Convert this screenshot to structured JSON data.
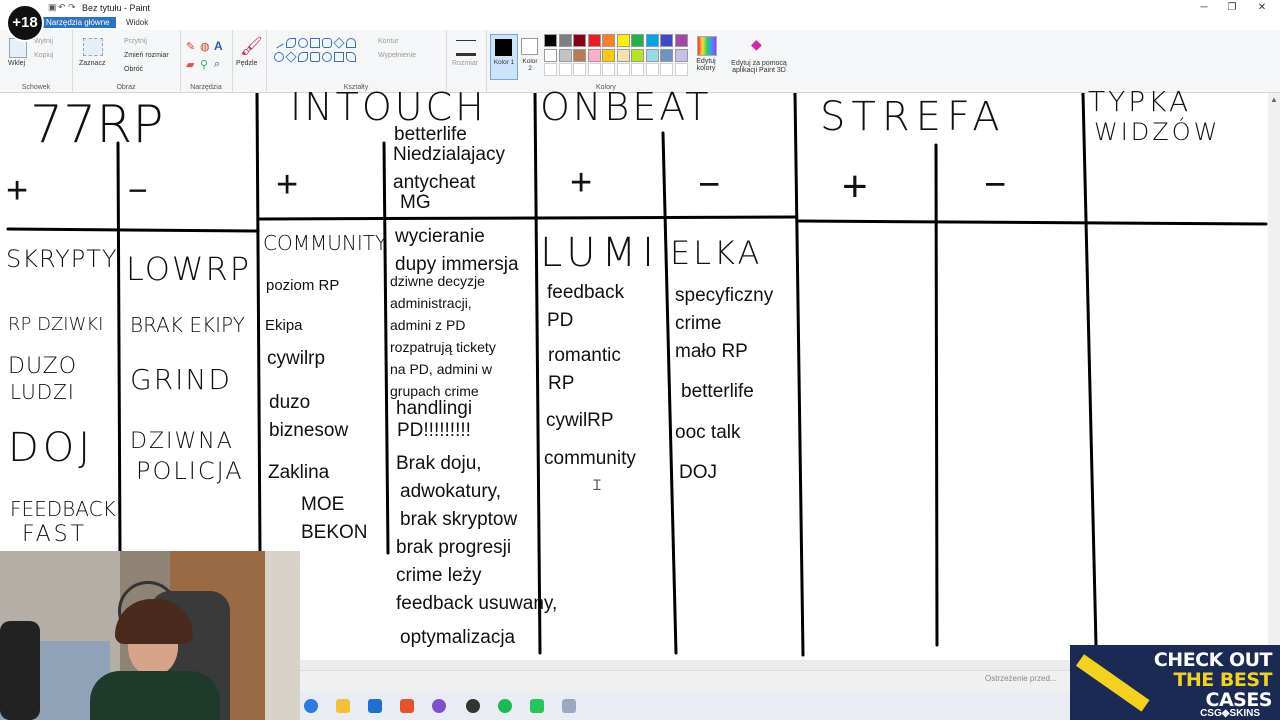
{
  "window": {
    "title": "Bez tytułu - Paint",
    "tabs": [
      "Narzędzia główne",
      "Widok"
    ],
    "controls": {
      "minimize": "─",
      "maximize": "❐",
      "close": "✕"
    }
  },
  "ribbon": {
    "schowek": {
      "label": "Schowek",
      "paste": "Wklej",
      "cut": "Wytnij",
      "copy": "Kopiuj"
    },
    "obraz": {
      "label": "Obraz",
      "select": "Zaznacz",
      "crop": "Przytnij",
      "resize": "Zmień rozmiar",
      "rotate": "Obróć"
    },
    "narzedzia": {
      "label": "Narzędzia"
    },
    "pedzle": {
      "label": "Pędzle"
    },
    "ksztalty": {
      "label": "Kształty",
      "outline": "Kontur",
      "fill": "Wypełnienie"
    },
    "size": {
      "label": "Rozmiar"
    },
    "kolory": {
      "label": "Kolory",
      "color1": "Kolor 1",
      "color2": "Kolor 2",
      "edit": "Edytuj kolory",
      "paint3d": "Edytuj za pomocą aplikacji Paint 3D"
    },
    "palette": [
      "#000000",
      "#7f7f7f",
      "#880015",
      "#ed1c24",
      "#ff7f27",
      "#fff200",
      "#22b14c",
      "#00a2e8",
      "#3f48cc",
      "#a349a4",
      "#ffffff",
      "#c3c3c3",
      "#b97a57",
      "#ffaec9",
      "#ffc90e",
      "#efe4b0",
      "#b5e61d",
      "#99d9ea",
      "#7092be",
      "#c8bfe7"
    ]
  },
  "canvas": {
    "headers": {
      "r77": "77RP",
      "intouch": "INTOUCH",
      "onbeat": "ONBEAT",
      "strefa": "STREFA",
      "typka1": "TYPKA",
      "typka2": "WIDZÓW"
    },
    "signs": {
      "plus": "+",
      "minus": "−"
    },
    "r77_plus": [
      "SKRYPTY",
      "RP DZIWKI",
      "DUZO",
      "LUDZI",
      "DOJ",
      "FEEDBACK",
      "FAST"
    ],
    "r77_minus": [
      "LOWRP",
      "BRAK EKIPY",
      "GRIND",
      "DZIWNA",
      "POLICJA"
    ],
    "intouch_plus": {
      "community": "COMMUNITY",
      "items": [
        "poziom RP",
        "Ekipa",
        "cywilrp",
        "duzo",
        "biznesow",
        "Zaklina",
        "MOE",
        "BEKON"
      ]
    },
    "intouch_minus_top": [
      "betterlife",
      "Niedzialajacy",
      "antycheat",
      "MG"
    ],
    "intouch_minus": {
      "l1": "wycieranie",
      "l2": "dupy immersja",
      "small": [
        "dziwne decyzje",
        "administracji,",
        "admini z PD",
        "rozpatrują tickety",
        "na PD, admini w",
        "grupach crime"
      ],
      "l3": "handlingi",
      "l4": "PD!!!!!!!!!",
      "l5": "Brak doju,",
      "l6": "adwokatury,",
      "l7": "brak skryptow",
      "l8": "brak progresji",
      "l9": "crime leży",
      "l10": "feedback usuwany,",
      "l11": "optymalizacja"
    },
    "onbeat_plus": {
      "heading": "LUMI",
      "items": [
        "feedback",
        "PD",
        "romantic",
        "RP",
        "cywilRP",
        "community"
      ]
    },
    "onbeat_minus": {
      "heading": "ELKA",
      "items": [
        "specyficzny",
        "crime",
        "mało RP",
        "betterlife",
        "ooc talk",
        "DOJ"
      ]
    }
  },
  "overlay": {
    "age_badge": "+18",
    "ad": {
      "line1": "CHECK OUT",
      "line2": "THE BEST",
      "line3": "CASES",
      "brand": "CSG◆SKINS"
    },
    "warning": "Ostrzeżenie przed..."
  }
}
